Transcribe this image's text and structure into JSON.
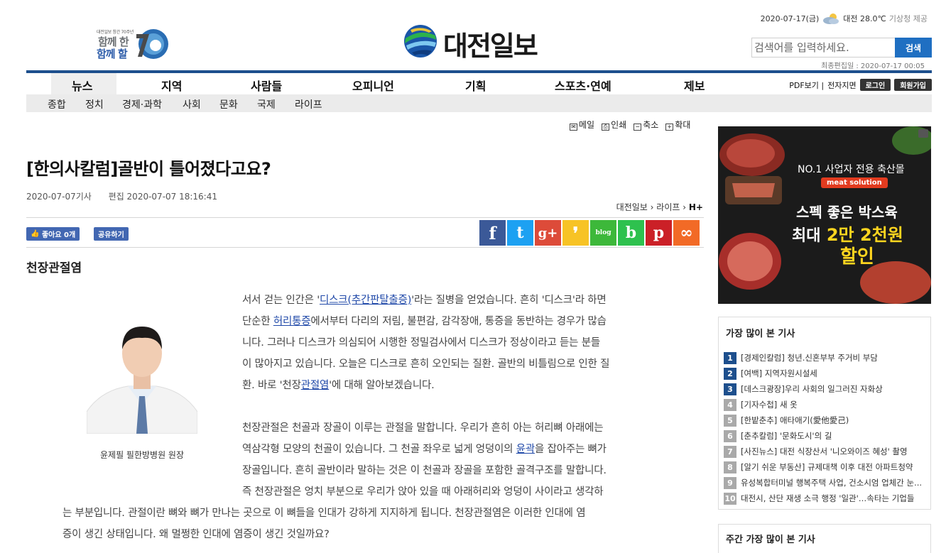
{
  "header": {
    "anniversary": {
      "small": "대전일보 창간 70주년",
      "line1": "함께 한",
      "line2": "함께 할"
    },
    "logo_text": "대전일보",
    "date_weather": {
      "date": "2020-07-17(금)",
      "city_temp": "대전 28.0℃",
      "source": "기상청 제공"
    },
    "search": {
      "placeholder": "검색어를 입력하세요.",
      "button": "검색"
    },
    "last_updated": "최종편집일 : 2020-07-17 00:05"
  },
  "nav": {
    "main": [
      "뉴스",
      "지역",
      "사람들",
      "오피니언",
      "기획",
      "스포츠·연예",
      "제보"
    ],
    "right": {
      "pdf": "PDF보기 |",
      "epaper": "전자지면",
      "login": "로그인",
      "join": "회원가입"
    },
    "sub": [
      "종합",
      "정치",
      "경제·과학",
      "사회",
      "문화",
      "국제",
      "라이프"
    ]
  },
  "tools": {
    "mail": "메일",
    "print": "인쇄",
    "shrink": "축소",
    "enlarge": "확대"
  },
  "article": {
    "title": "[한의사칼럼]골반이 틀어졌다고요?",
    "date": "2020-07-07기사",
    "edited": "편집 2020-07-07 18:16:41",
    "breadcrumb": [
      "대전일보",
      "라이프",
      "H+"
    ],
    "fb_like": "좋아요 0개",
    "share": "공유하기",
    "subheading": "천장관절염",
    "photo_caption": "윤제필 필한방병원 원장",
    "p1": [
      [
        "서서 걷는 인간은 '",
        {
          "link": "디스크(추간판탈출증)"
        },
        "'라는 질병을 얻었습니다. 흔히 '디스크'라 하면"
      ],
      [
        "단순한 ",
        {
          "link": "허리통증"
        },
        "에서부터 다리의 저림, 불편감, 감각장애, 통증을 동반하는 경우가 많습"
      ],
      [
        "니다. 그러나 디스크가 의심되어 시행한 정밀검사에서 디스크가 정상이라고 듣는 분들"
      ],
      [
        "이 많아지고 있습니다. 오늘은 디스크로 흔히 오인되는 질환. 골반의 비틀림으로 인한 질"
      ],
      [
        "환. 바로 '천장",
        {
          "link": "관절염"
        },
        "'에 대해 알아보겠습니다."
      ]
    ],
    "p2": [
      [
        "천장관절은 천골과 장골이 이루는 관절을 말합니다. 우리가 흔히 아는 허리뼈 아래에는"
      ],
      [
        "역삼각형 모양의 천골이 있습니다. 그 천골 좌우로 넓게 엉덩이의 ",
        {
          "link": "윤곽"
        },
        "을 잡아주는 뼈가"
      ],
      [
        "장골입니다. 흔히 골반이라 말하는 것은 이 천골과 장골을 포함한 골격구조를 말합니다."
      ],
      [
        "즉 천장관절은 엉치 부분으로 우리가 앉아 있을 때 아래허리와 엉덩이 사이라고 생각하"
      ]
    ],
    "p2_wide": [
      [
        "는 부분입니다. 관절이란 뼈와 뼈가 만나는 곳으로 이 뼈들을 인대가 강하게 지지하게 됩니다. 천장관절염은 이러한 인대에 염"
      ],
      [
        "증이 생긴 상태입니다. 왜 멀쩡한 인대에 염증이 생긴 것일까요?"
      ]
    ]
  },
  "share_buttons": [
    {
      "name": "facebook-icon",
      "glyph": "f",
      "color": "#3b5998"
    },
    {
      "name": "twitter-icon",
      "glyph": "t",
      "color": "#1da1f2"
    },
    {
      "name": "googleplus-icon",
      "glyph": "g+",
      "color": "#dd4b39"
    },
    {
      "name": "kakaostory-icon",
      "glyph": "❜",
      "color": "#f7c325"
    },
    {
      "name": "naver-blog-icon",
      "glyph": "blog",
      "color": "#3db83a"
    },
    {
      "name": "band-icon",
      "glyph": "b",
      "color": "#2ec14e"
    },
    {
      "name": "pinterest-icon",
      "glyph": "p",
      "color": "#cb2027"
    },
    {
      "name": "link-copy-icon",
      "glyph": "∞",
      "color": "#f26a26"
    }
  ],
  "ad": {
    "line1": "NO.1 사업자 전용 축산몰",
    "tag": "meat solution",
    "line2": "스펙 좋은 박스육",
    "line3a": "최대",
    "line3b": "2만 2천원",
    "line4": "할인"
  },
  "popular": {
    "title": "가장 많이 본 기사",
    "items": [
      "[경제인칼럼] 청년.신혼부부 주거비 부담",
      "[여백] 지역자원시설세",
      "[데스크광장]우리 사회의 일그러진 자화상",
      "[기자수첩] 새 옷",
      "[한밭춘추] 애타애기(愛他愛己)",
      "[춘추칼럼] '문화도시'의 길",
      "[사진뉴스] 대전 식장산서 '니오와이즈 혜성' 촬영",
      "[알기 쉬운 부동산] 규제대책 이후 대전 아파트청약",
      "유성복합터미널 행복주택 사업, 건소시엄 업체간 눈...",
      "대전시, 산단 재생 소극 행정 '일관'…속타는 기업들"
    ]
  },
  "weekly_title": "주간 가장 많이 본 기사"
}
